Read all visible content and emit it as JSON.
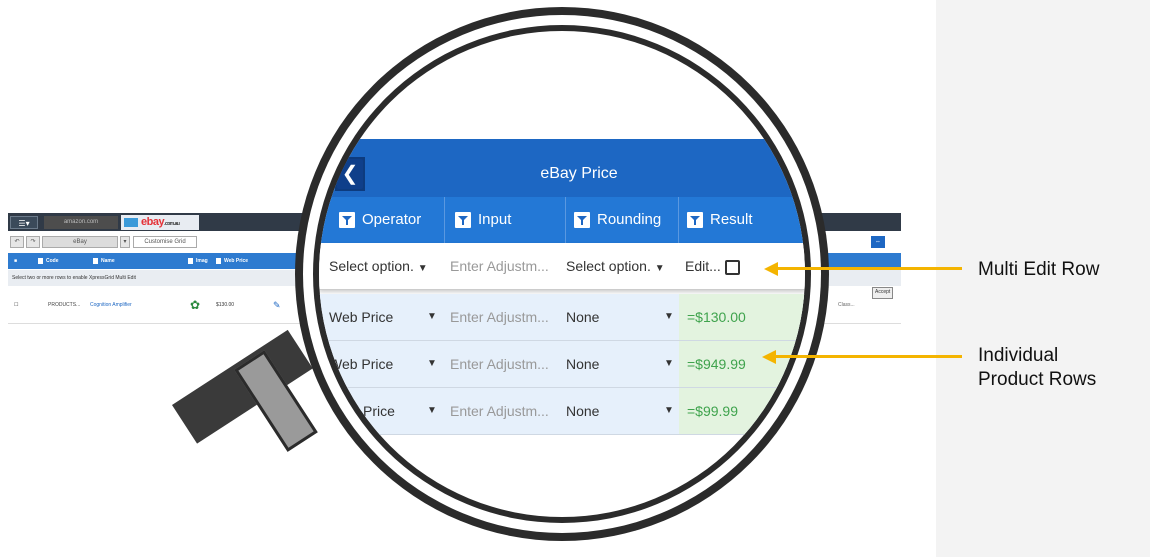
{
  "background_grid": {
    "menu_icon": "grid-menu-icon",
    "amazon_tab": "amazon.com",
    "ebay_tab_logo": "ebay",
    "ebay_tab_suffix": ".com.au",
    "view_select": "eBay",
    "customise_label": "Customise Grid",
    "headers": [
      "Code",
      "Name",
      "Imag",
      "Web Price"
    ],
    "note": "Select two or more rows to enable XpressGrid Multi Edit",
    "row": {
      "code": "PRODUCTS...",
      "name": "Cognition Amplifier",
      "price": "$130.00",
      "class": "Class...",
      "action": "Accept"
    }
  },
  "magnified": {
    "title": "eBay Price",
    "back_icon": "chevron-left-icon",
    "columns": [
      "Operator",
      "Input",
      "Rounding",
      "Result"
    ],
    "multi_edit": {
      "operator": "Select option.",
      "input_placeholder": "Enter Adjustm...",
      "rounding": "Select option.",
      "result": "Edit..."
    },
    "rows": [
      {
        "operator": "Web Price",
        "input": "Enter Adjustm...",
        "rounding": "None",
        "result": "=$130.00"
      },
      {
        "operator": "Web Price",
        "input": "Enter Adjustm...",
        "rounding": "None",
        "result": "=$949.99"
      },
      {
        "operator": "Price",
        "input": "Enter Adjustm...",
        "rounding": "None",
        "result": "=$99.99"
      }
    ]
  },
  "annotations": {
    "multi_edit_label": "Multi Edit Row",
    "product_rows_label_1": "Individual",
    "product_rows_label_2": "Product Rows",
    "arrow_color": "#f4b400"
  }
}
